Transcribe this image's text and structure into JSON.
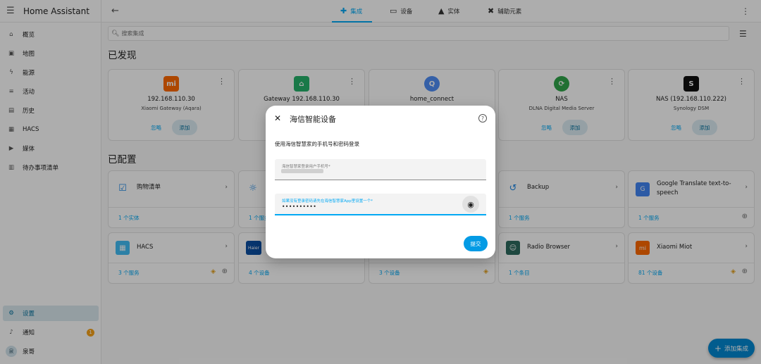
{
  "app": {
    "title": "Home Assistant"
  },
  "sidebar": {
    "items": [
      {
        "label": "概览",
        "icon": "home-icon"
      },
      {
        "label": "地图",
        "icon": "map-icon"
      },
      {
        "label": "能源",
        "icon": "lightning-icon"
      },
      {
        "label": "活动",
        "icon": "list-icon"
      },
      {
        "label": "历史",
        "icon": "chart-icon"
      },
      {
        "label": "HACS",
        "icon": "hacs-icon"
      },
      {
        "label": "媒体",
        "icon": "media-icon"
      },
      {
        "label": "待办事项清单",
        "icon": "clipboard-icon"
      }
    ],
    "bottom": {
      "settings_label": "设置",
      "notifications_label": "通知",
      "notifications_count": "1",
      "user_label": "泉哥",
      "user_initial": "泉"
    }
  },
  "topbar": {
    "tabs": [
      {
        "label": "集成"
      },
      {
        "label": "设备"
      },
      {
        "label": "实体"
      },
      {
        "label": "辅助元素"
      }
    ]
  },
  "search": {
    "placeholder": "搜索集成"
  },
  "discovered": {
    "title": "已发现",
    "ignore_label": "忽略",
    "add_label": "添加",
    "cards": [
      {
        "name": "192.168.110.30",
        "sub": "Xiaomi Gateway (Aqara)",
        "logo": "mi-logo",
        "color": "#ff6900"
      },
      {
        "name": "Gateway 192.168.110.30",
        "sub": "",
        "logo": "mijia-logo",
        "color": "#25b36b"
      },
      {
        "name": "home_connect",
        "sub": "",
        "logo": "home-connect-logo",
        "color": "#4f8ef7"
      },
      {
        "name": "NAS",
        "sub": "DLNA Digital Media Server",
        "logo": "dlna-logo",
        "color": "#30a64a"
      },
      {
        "name": "NAS (192.168.110.222)",
        "sub": "Synology DSM",
        "logo": "synology-logo",
        "color": "#111111"
      }
    ]
  },
  "configured": {
    "title": "已配置",
    "row1": [
      {
        "name": "购物清单",
        "footer": "1 个实体",
        "icon": "checklist-icon"
      },
      {
        "name": "",
        "footer": "1 个服务",
        "icon": "sun-icon"
      },
      {
        "name": "Backup",
        "footer": "1 个服务",
        "icon": "backup-icon"
      },
      {
        "name": "Google Translate text-to-speech",
        "footer": "1 个服务",
        "icon": "google-translate-icon"
      }
    ],
    "row2": [
      {
        "name": "HACS",
        "footer": "3 个服务",
        "icon": "hacs-icon"
      },
      {
        "name": "",
        "footer": "4 个设备",
        "icon": "haier-logo",
        "logo_text": "Haier"
      },
      {
        "name": "",
        "footer": "3 个设备",
        "icon": "unknown-icon"
      },
      {
        "name": "Radio Browser",
        "footer": "1 个条目",
        "icon": "radio-browser-icon"
      },
      {
        "name": "Xiaomi Miot",
        "footer": "81 个设备",
        "icon": "mi-logo"
      }
    ]
  },
  "dialog": {
    "title": "海信智能设备",
    "description": "使用海信智慧家的手机号和密码登录",
    "phone_label": "海信智慧家登录用户手机号*",
    "password_label": "如果没有登录密码请先在海信智慧家App里设置一个*",
    "password_value": "••••••••••",
    "submit_label": "提交"
  },
  "fab": {
    "label": "添加集成"
  },
  "colors": {
    "accent": "#03a9f4",
    "fab": "#0288d1",
    "badge": "#f7a21a"
  }
}
